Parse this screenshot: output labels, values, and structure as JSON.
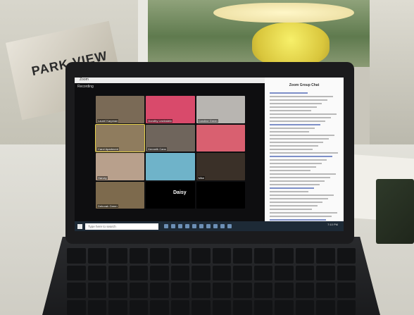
{
  "photo": {
    "magazine_cover_text": "PARK VIEW"
  },
  "zoom": {
    "window_title": "Zoom",
    "recording_label": "Recording",
    "active_speaker": "Daisy",
    "participants": [
      {
        "label": "Laurel Karpman",
        "color": "#7a6a56"
      },
      {
        "label": "Dorothy Lewinstein",
        "color": "#d94a6b"
      },
      {
        "label": "Caroline Green",
        "color": "#b8b5b1"
      },
      {
        "label": "Carol Apartment",
        "color": "#8f7c5e"
      },
      {
        "label": "Kenneth Cano",
        "color": "#6f655c"
      },
      {
        "label": "",
        "color": "#d96070"
      },
      {
        "label": "Harvey",
        "color": "#b8a08c"
      },
      {
        "label": "",
        "color": "#6fb3c9"
      },
      {
        "label": "Mike",
        "color": "#3a3028"
      },
      {
        "label": "Deborah Green",
        "color": "#7d6a4d"
      },
      {
        "label": "",
        "color": "#000000"
      },
      {
        "label": "",
        "color": "#000000"
      }
    ]
  },
  "document": {
    "title": "Zoom Group Chat"
  },
  "taskbar": {
    "search_placeholder": "Type here to search",
    "time": "7:10 PM"
  }
}
